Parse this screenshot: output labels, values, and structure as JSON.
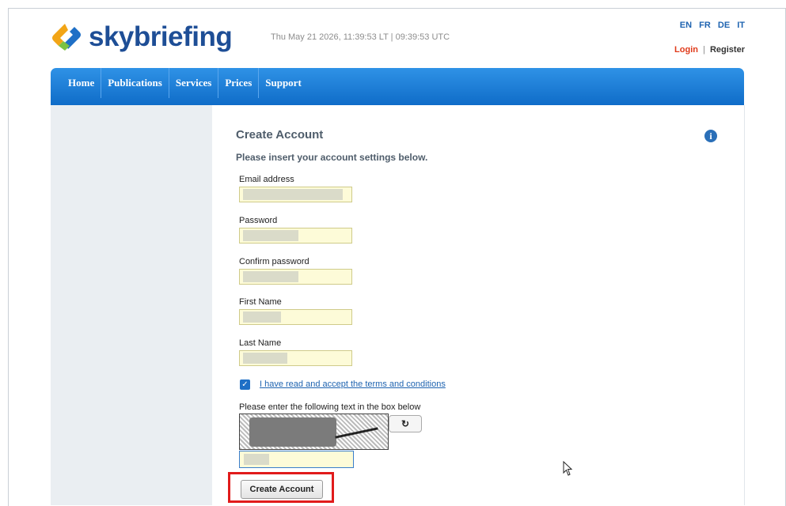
{
  "header": {
    "brand": "skybriefing",
    "datetime": "Thu May 21 2026, 11:39:53 LT | 09:39:53 UTC",
    "languages": [
      "EN",
      "FR",
      "DE",
      "IT"
    ],
    "login_label": "Login",
    "separator": "|",
    "register_label": "Register"
  },
  "nav": {
    "items": [
      "Home",
      "Publications",
      "Services",
      "Prices",
      "Support"
    ]
  },
  "form": {
    "title": "Create Account",
    "subtitle": "Please insert your account settings below.",
    "email_label": "Email address",
    "password_label": "Password",
    "confirm_label": "Confirm password",
    "first_name_label": "First Name",
    "last_name_label": "Last Name",
    "terms_checked": true,
    "terms_label": "I have read and accept the terms and conditions",
    "captcha_label": "Please enter the following text in the box below",
    "submit_label": "Create Account"
  },
  "icons": {
    "info": "info-icon",
    "refresh": "refresh-icon",
    "checkbox": "checkbox-checked-icon",
    "cursor": "mouse-cursor-icon"
  },
  "colors": {
    "brand_blue": "#1e4e96",
    "nav_blue": "#0f6cc8",
    "login_red": "#e03a1a",
    "highlight_red": "#e11b1b",
    "field_bg": "#fdfbd8"
  }
}
